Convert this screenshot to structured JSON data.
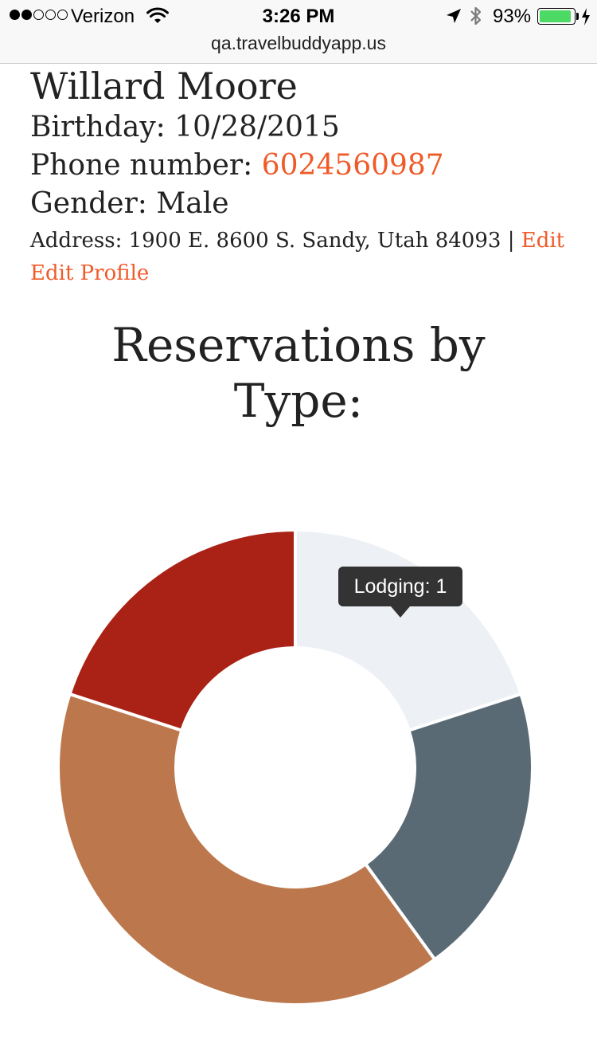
{
  "status_bar": {
    "carrier": "Verizon",
    "time": "3:26 PM",
    "battery_percent": "93%",
    "battery_level": 0.93,
    "signal_bars_filled": 2,
    "signal_bars_total": 5,
    "icons": [
      "wifi-icon",
      "location-arrow-icon",
      "bluetooth-icon",
      "battery-icon",
      "charging-bolt-icon"
    ]
  },
  "browser": {
    "url": "qa.travelbuddyapp.us"
  },
  "profile": {
    "name": "Willard Moore",
    "birthday_label": "Birthday:",
    "birthday_value": "10/28/2015",
    "phone_label": "Phone number:",
    "phone_value": "6024560987",
    "gender_label": "Gender:",
    "gender_value": "Male",
    "address_label": "Address:",
    "address_value": "1900 E. 8600 S. Sandy, Utah 84093",
    "address_separator": "|",
    "address_edit_link": "Edit",
    "edit_profile_link": "Edit Profile"
  },
  "colors": {
    "link": "#f05a28",
    "text": "#222222",
    "tooltip_bg": "#333333"
  },
  "chart_data": {
    "type": "pie",
    "donut": true,
    "title": "Reservations by Type:",
    "slices": [
      {
        "label": "Lodging",
        "value": 1,
        "color": "#edf0f5"
      },
      {
        "label": "",
        "value": 1,
        "color": "#5a6a75"
      },
      {
        "label": "",
        "value": 2,
        "color": "#bc784c"
      },
      {
        "label": "",
        "value": 1,
        "color": "#aa2116"
      }
    ],
    "tooltip": {
      "label": "Lodging",
      "value": 1,
      "text": "Lodging: 1"
    }
  }
}
